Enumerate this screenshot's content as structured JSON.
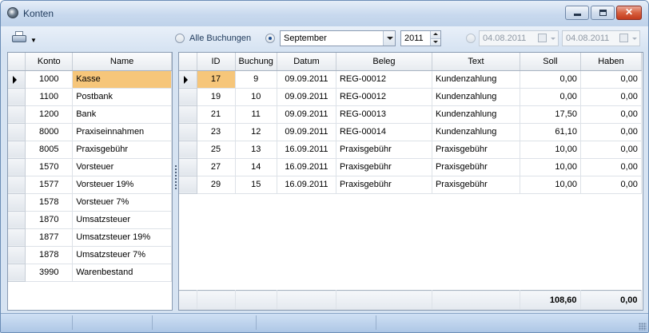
{
  "window": {
    "title": "Konten"
  },
  "toolbar": {
    "print_icon": "printer-icon",
    "radio_all_label": "Alle Buchungen",
    "radio_all_selected": false,
    "radio_month_selected": true,
    "month_value": "September",
    "year_value": "2011",
    "radio_range_selected": false,
    "date_from": "04.08.2011",
    "date_to": "04.08.2011"
  },
  "accounts": {
    "headers": [
      "Konto",
      "Name"
    ],
    "rows": [
      {
        "konto": "1000",
        "name": "Kasse"
      },
      {
        "konto": "1100",
        "name": "Postbank"
      },
      {
        "konto": "1200",
        "name": "Bank"
      },
      {
        "konto": "8000",
        "name": "Praxiseinnahmen"
      },
      {
        "konto": "8005",
        "name": "Praxisgebühr"
      },
      {
        "konto": "1570",
        "name": "Vorsteuer"
      },
      {
        "konto": "1577",
        "name": "Vorsteuer 19%"
      },
      {
        "konto": "1578",
        "name": "Vorsteuer 7%"
      },
      {
        "konto": "1870",
        "name": "Umsatzsteuer"
      },
      {
        "konto": "1877",
        "name": "Umsatzsteuer 19%"
      },
      {
        "konto": "1878",
        "name": "Umsatzsteuer 7%"
      },
      {
        "konto": "3990",
        "name": "Warenbestand"
      }
    ]
  },
  "bookings": {
    "headers": [
      "ID",
      "Buchung",
      "Datum",
      "Beleg",
      "Text",
      "Soll",
      "Haben"
    ],
    "rows": [
      {
        "id": "17",
        "buchung": "9",
        "datum": "09.09.2011",
        "beleg": "REG-00012",
        "text": "Kundenzahlung",
        "soll": "0,00",
        "haben": "0,00"
      },
      {
        "id": "19",
        "buchung": "10",
        "datum": "09.09.2011",
        "beleg": "REG-00012",
        "text": "Kundenzahlung",
        "soll": "0,00",
        "haben": "0,00"
      },
      {
        "id": "21",
        "buchung": "11",
        "datum": "09.09.2011",
        "beleg": "REG-00013",
        "text": "Kundenzahlung",
        "soll": "17,50",
        "haben": "0,00"
      },
      {
        "id": "23",
        "buchung": "12",
        "datum": "09.09.2011",
        "beleg": "REG-00014",
        "text": "Kundenzahlung",
        "soll": "61,10",
        "haben": "0,00"
      },
      {
        "id": "25",
        "buchung": "13",
        "datum": "16.09.2011",
        "beleg": "Praxisgebühr",
        "text": "Praxisgebühr",
        "soll": "10,00",
        "haben": "0,00"
      },
      {
        "id": "27",
        "buchung": "14",
        "datum": "16.09.2011",
        "beleg": "Praxisgebühr",
        "text": "Praxisgebühr",
        "soll": "10,00",
        "haben": "0,00"
      },
      {
        "id": "29",
        "buchung": "15",
        "datum": "16.09.2011",
        "beleg": "Praxisgebühr",
        "text": "Praxisgebühr",
        "soll": "10,00",
        "haben": "0,00"
      }
    ],
    "totals": {
      "soll": "108,60",
      "haben": "0,00"
    }
  },
  "colors": {
    "selection": "#f6c67a",
    "window_frame": "#d6e3f2"
  }
}
